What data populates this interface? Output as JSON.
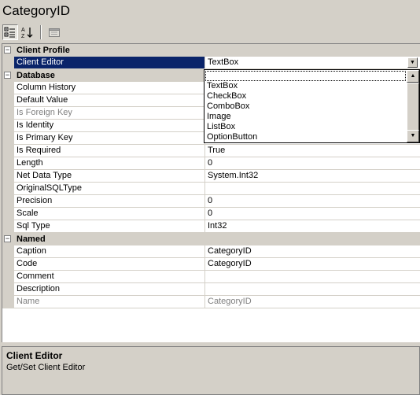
{
  "title": "CategoryID",
  "toolbar": {
    "buttons": [
      {
        "name": "categorized-icon",
        "pressed": true
      },
      {
        "name": "alphabetical-icon",
        "pressed": false
      },
      {
        "name": "property-pages-icon",
        "pressed": false
      }
    ]
  },
  "grid": {
    "categories": [
      {
        "name": "Client Profile",
        "expander": "−",
        "properties": [
          {
            "name": "Client Editor",
            "value": "TextBox",
            "selected": true
          }
        ]
      },
      {
        "name": "Database",
        "expander": "−",
        "properties": [
          {
            "name": "Column History",
            "value": ""
          },
          {
            "name": "Default Value",
            "value": ""
          },
          {
            "name": "Is Foreign Key",
            "value": "",
            "readonly": true
          },
          {
            "name": "Is Identity",
            "value": ""
          },
          {
            "name": "Is Primary Key",
            "value": ""
          },
          {
            "name": "Is Required",
            "value": "True"
          },
          {
            "name": "Length",
            "value": "0"
          },
          {
            "name": "Net Data Type",
            "value": "System.Int32"
          },
          {
            "name": "OriginalSQLType",
            "value": ""
          },
          {
            "name": "Precision",
            "value": "0"
          },
          {
            "name": "Scale",
            "value": "0"
          },
          {
            "name": "Sql Type",
            "value": "Int32"
          }
        ]
      },
      {
        "name": "Named",
        "expander": "−",
        "properties": [
          {
            "name": "Caption",
            "value": "CategoryID"
          },
          {
            "name": "Code",
            "value": "CategoryID"
          },
          {
            "name": "Comment",
            "value": ""
          },
          {
            "name": "Description",
            "value": ""
          },
          {
            "name": "Name",
            "value": "CategoryID",
            "readonly": true
          }
        ]
      }
    ]
  },
  "dropdown": {
    "options": [
      "TextBox",
      "CheckBox",
      "ComboBox",
      "Image",
      "ListBox",
      "OptionButton"
    ]
  },
  "help": {
    "title": "Client Editor",
    "description": "Get/Set Client Editor"
  }
}
